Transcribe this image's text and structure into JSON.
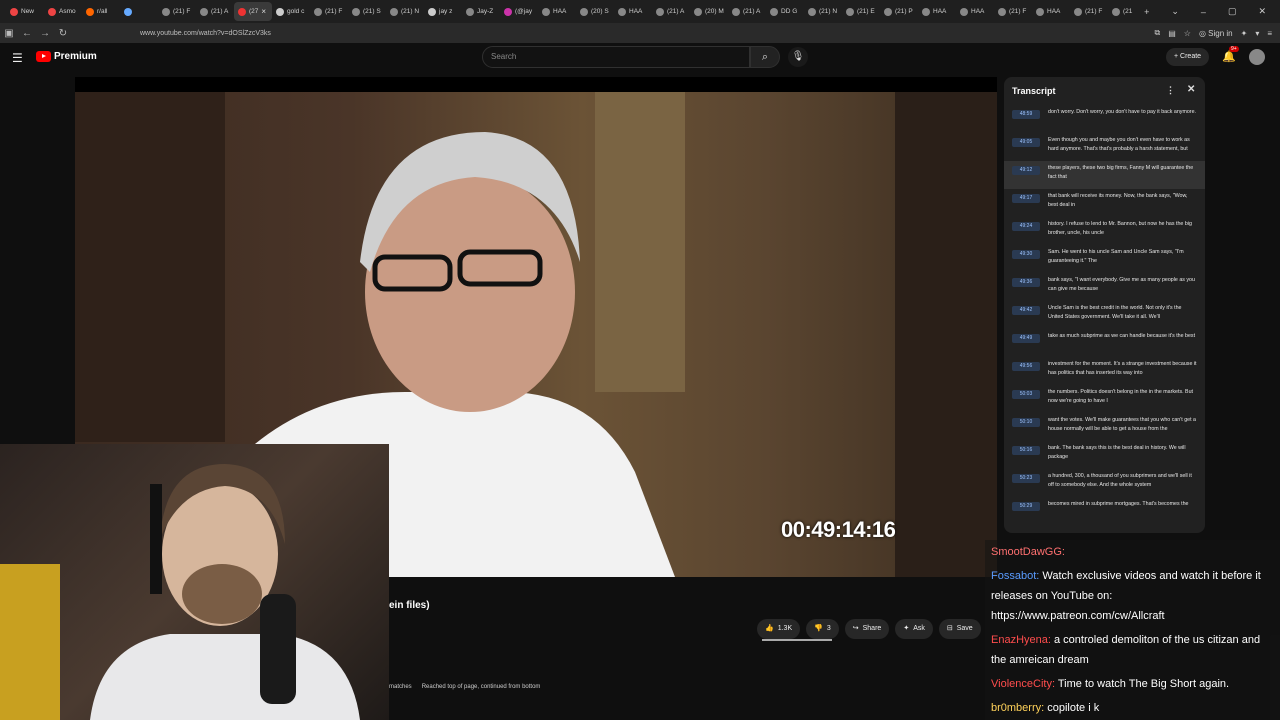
{
  "browser": {
    "tabs": [
      {
        "label": "New",
        "color": "#e44"
      },
      {
        "label": "Asmo",
        "color": "#e44"
      },
      {
        "label": "r/all",
        "color": "#f60"
      },
      {
        "label": "",
        "color": "#6af"
      },
      {
        "label": "(21) F",
        "color": "#888"
      },
      {
        "label": "(21) A",
        "color": "#888"
      },
      {
        "label": "(27",
        "color": "#e33",
        "active": true
      },
      {
        "label": "gold c",
        "color": "#ccc"
      },
      {
        "label": "(21) F",
        "color": "#888"
      },
      {
        "label": "(21) S",
        "color": "#888"
      },
      {
        "label": "(21) N",
        "color": "#888"
      },
      {
        "label": "jay z",
        "color": "#ccc"
      },
      {
        "label": "Jay-Z",
        "color": "#888"
      },
      {
        "label": "(@jay",
        "color": "#c3a"
      },
      {
        "label": "HAA",
        "color": "#888"
      },
      {
        "label": "(20) S",
        "color": "#888"
      },
      {
        "label": "HAA",
        "color": "#888"
      },
      {
        "label": "(21) A",
        "color": "#888"
      },
      {
        "label": "(20) M",
        "color": "#888"
      },
      {
        "label": "(21) A",
        "color": "#888"
      },
      {
        "label": "DD G",
        "color": "#888"
      },
      {
        "label": "(21) N",
        "color": "#888"
      },
      {
        "label": "(21) E",
        "color": "#888"
      },
      {
        "label": "(21) P",
        "color": "#888"
      },
      {
        "label": "HAA",
        "color": "#888"
      },
      {
        "label": "HAA",
        "color": "#888"
      },
      {
        "label": "(21) F",
        "color": "#888"
      },
      {
        "label": "HAA",
        "color": "#888"
      },
      {
        "label": "(21) F",
        "color": "#888"
      },
      {
        "label": "(21",
        "color": "#888"
      }
    ],
    "url": "www.youtube.com/watch?v=dOSlZzcV3ks",
    "signin_label": "Sign in"
  },
  "youtube": {
    "brand": "Premium",
    "search_placeholder": "Search",
    "create_label": "Create",
    "notif_count": "9+"
  },
  "video": {
    "timecode": "00:49:14:16",
    "title_fragment": "ein files)",
    "like_count": "1.3K",
    "dislike_count": "3",
    "share_label": "Share",
    "ask_label": "Ask",
    "save_label": "Save",
    "find_matches": "matches",
    "find_status": "Reached top of page, continued from bottom"
  },
  "transcript": {
    "title": "Transcript",
    "segments": [
      {
        "time": "48:59",
        "text": "don't worry. Don't worry, you don't have to pay it back anymore."
      },
      {
        "time": "49:05",
        "text": "Even though you and maybe you don't even have to work as hard anymore. That's that's probably a harsh statement, but"
      },
      {
        "time": "49:12",
        "text": "these players, these two big firms, Fanny M will guarantee the fact that",
        "highlight": true
      },
      {
        "time": "49:17",
        "text": "that bank will receive its money. Now, the bank says, \"Wow, best deal in"
      },
      {
        "time": "49:24",
        "text": "history. I refuse to lend to Mr. Bannon, but now he has the big brother, uncle, his uncle"
      },
      {
        "time": "49:30",
        "text": "Sam. He went to his uncle Sam and Uncle Sam says, \"I'm guaranteeing it.\" The"
      },
      {
        "time": "49:36",
        "text": "bank says, \"I want everybody. Give me as many people as you can give me because"
      },
      {
        "time": "49:42",
        "text": "Uncle Sam is the best credit in the world. Not only it's the United States government. We'll take it all. We'll"
      },
      {
        "time": "49:49",
        "text": "take as much subprime as we can handle because it's the best"
      },
      {
        "time": "49:56",
        "text": "investment for the moment. It's a strange investment because it has politics that has inserted its way into"
      },
      {
        "time": "50:03",
        "text": "the numbers. Politics doesn't belong in the in the markets. But now we're going to have I"
      },
      {
        "time": "50:10",
        "text": "want the votes. We'll make guarantees that you who can't get a house normally will be able to get a house from the"
      },
      {
        "time": "50:16",
        "text": "bank. The bank says this is the best deal in history. We will package"
      },
      {
        "time": "50:23",
        "text": "a hundred, 300, a thousand of you subprimers and we'll sell it off to somebody else. And the whole system"
      },
      {
        "time": "50:29",
        "text": "becomes mired in subprime mortgages. That's becomes the"
      }
    ]
  },
  "chat": [
    {
      "user": "SmootDawGG:",
      "color": "#ff7070",
      "text": ""
    },
    {
      "user": "Fossabot:",
      "color": "#5a9cff",
      "text": "Watch exclusive videos and watch it before it releases on YouTube on: https://www.patreon.com/cw/Allcraft"
    },
    {
      "user": "EnazHyena:",
      "color": "#ff4d4d",
      "text": "a controled demoliton of the us citizan and the amreican dream"
    },
    {
      "user": "ViolenceCity:",
      "color": "#ff4d4d",
      "text": "Time to watch The Big Short again."
    },
    {
      "user": "br0mberry:",
      "color": "#ffd25a",
      "text": "copilote i k"
    }
  ]
}
